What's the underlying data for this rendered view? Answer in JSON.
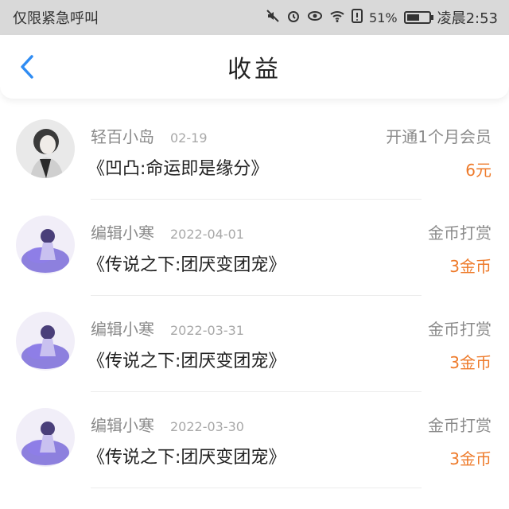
{
  "status_bar": {
    "carrier": "仅限紧急呼叫",
    "battery_percent": "51%",
    "time": "凌晨2:53",
    "icons": [
      "mute-icon",
      "alarm-icon",
      "eye-icon",
      "wifi-icon",
      "alert-icon",
      "battery-icon"
    ]
  },
  "header": {
    "title": "收益",
    "back_icon": "chevron-left-icon"
  },
  "colors": {
    "accent": "#2f8cf3",
    "amount": "#ee7a2a",
    "status_bg": "#d9d9d9"
  },
  "items": [
    {
      "author": "轻百小岛",
      "date": "02-19",
      "type": "开通1个月会员",
      "book": "《凹凸:命运即是缘分》",
      "amount": "6元"
    },
    {
      "author": "编辑小寒",
      "date": "2022-04-01",
      "type": "金币打赏",
      "book": "《传说之下:团厌变团宠》",
      "amount": "3金币"
    },
    {
      "author": "编辑小寒",
      "date": "2022-03-31",
      "type": "金币打赏",
      "book": "《传说之下:团厌变团宠》",
      "amount": "3金币"
    },
    {
      "author": "编辑小寒",
      "date": "2022-03-30",
      "type": "金币打赏",
      "book": "《传说之下:团厌变团宠》",
      "amount": "3金币"
    }
  ]
}
